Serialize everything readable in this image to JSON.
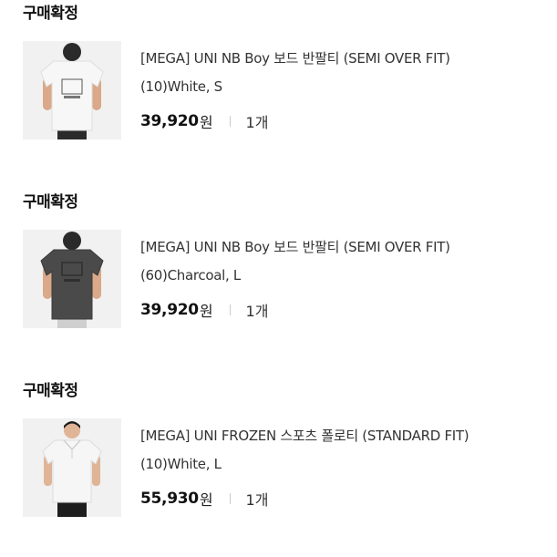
{
  "orders": [
    {
      "status": "구매확정",
      "product_name": "[MEGA] UNI NB Boy 보드 반팔티 (SEMI OVER FIT)",
      "option": "(10)White, S",
      "price": "39,920",
      "currency": "원",
      "quantity": "1개",
      "thumbnail": {
        "shirt_color": "#f4f4f4",
        "pants_color": "#2b2b2b",
        "view": "back"
      }
    },
    {
      "status": "구매확정",
      "product_name": "[MEGA] UNI NB Boy 보드 반팔티 (SEMI OVER FIT)",
      "option": "(60)Charcoal, L",
      "price": "39,920",
      "currency": "원",
      "quantity": "1개",
      "thumbnail": {
        "shirt_color": "#4a4a4a",
        "pants_color": "#cfcfcf",
        "view": "back"
      }
    },
    {
      "status": "구매확정",
      "product_name": "[MEGA] UNI FROZEN 스포츠 폴로티 (STANDARD FIT)",
      "option": "(10)White, L",
      "price": "55,930",
      "currency": "원",
      "quantity": "1개",
      "thumbnail": {
        "shirt_color": "#f6f6f6",
        "pants_color": "#1e1e1e",
        "view": "front-polo"
      }
    }
  ]
}
